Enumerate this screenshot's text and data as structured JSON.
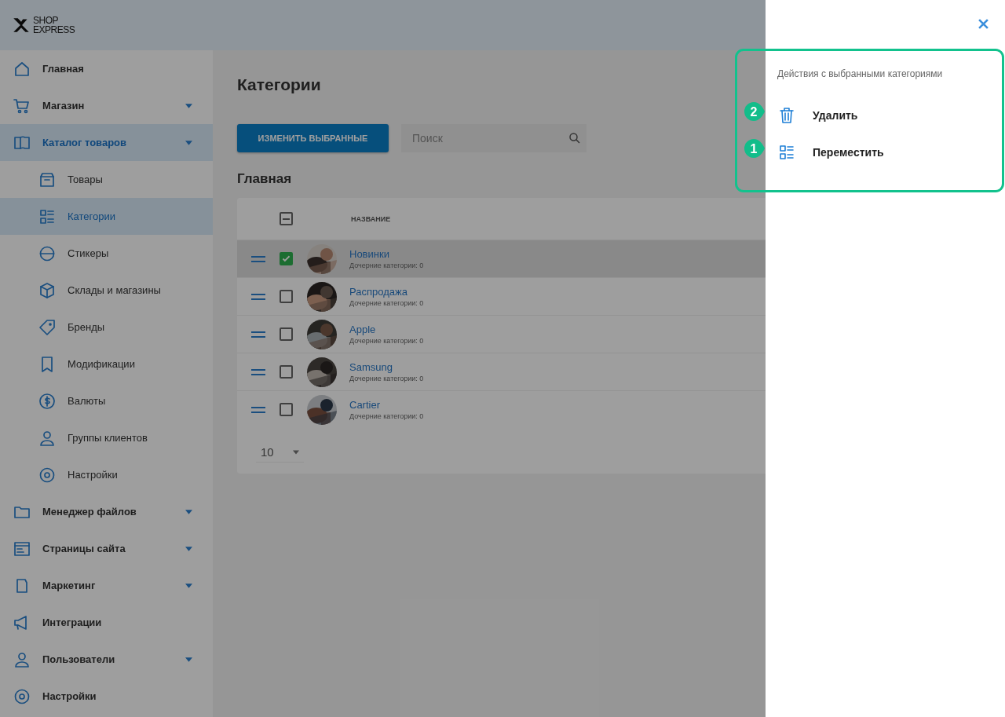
{
  "logo": {
    "line1": "SHOP",
    "line2": "EXPRESS"
  },
  "sidebar": {
    "items": [
      {
        "label": "Главная",
        "has_submenu": false,
        "selected": false
      },
      {
        "label": "Магазин",
        "has_submenu": true,
        "selected": false
      },
      {
        "label": "Каталог товаров",
        "has_submenu": true,
        "selected": true,
        "children": [
          {
            "label": "Товары",
            "selected": false
          },
          {
            "label": "Категории",
            "selected": true
          },
          {
            "label": "Стикеры",
            "selected": false
          },
          {
            "label": "Склады и магазины",
            "selected": false
          },
          {
            "label": "Бренды",
            "selected": false
          },
          {
            "label": "Модификации",
            "selected": false
          },
          {
            "label": "Валюты",
            "selected": false
          },
          {
            "label": "Группы клиентов",
            "selected": false
          },
          {
            "label": "Настройки",
            "selected": false
          }
        ]
      },
      {
        "label": "Менеджер файлов",
        "has_submenu": true,
        "selected": false
      },
      {
        "label": "Страницы сайта",
        "has_submenu": true,
        "selected": false
      },
      {
        "label": "Маркетинг",
        "has_submenu": true,
        "selected": false
      },
      {
        "label": "Интеграции",
        "has_submenu": false,
        "selected": false
      },
      {
        "label": "Пользователи",
        "has_submenu": true,
        "selected": false
      },
      {
        "label": "Настройки",
        "has_submenu": false,
        "selected": false
      }
    ]
  },
  "main": {
    "title": "Категории",
    "edit_button": "ИЗМЕНИТЬ ВЫБРАННЫЕ",
    "search": {
      "placeholder": "Поиск"
    },
    "section": "Главная",
    "table": {
      "select_all_indeterminate": true,
      "columns": [
        "НАЗВАНИЕ"
      ],
      "rows": [
        {
          "name": "Новинки",
          "subtitle": "Дочерние категории: 0",
          "checked": true,
          "selected": true
        },
        {
          "name": "Распродажа",
          "subtitle": "Дочерние категории: 0",
          "checked": false,
          "selected": false
        },
        {
          "name": "Apple",
          "subtitle": "Дочерние категории: 0",
          "checked": false,
          "selected": false
        },
        {
          "name": "Samsung",
          "subtitle": "Дочерние категории: 0",
          "checked": false,
          "selected": false
        },
        {
          "name": "Cartier",
          "subtitle": "Дочерние категории: 0",
          "checked": false,
          "selected": false
        }
      ]
    },
    "page_size": "10"
  },
  "drawer": {
    "heading": "Действия с выбранными категориями",
    "actions": [
      {
        "label": "Удалить",
        "callout": "2"
      },
      {
        "label": "Переместить",
        "callout": "1"
      }
    ]
  }
}
